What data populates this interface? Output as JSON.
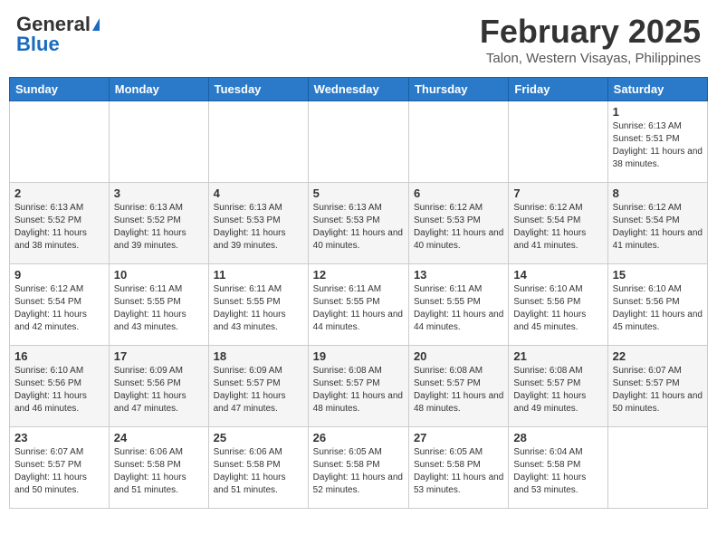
{
  "header": {
    "logo_line1": "General",
    "logo_line2": "Blue",
    "month_year": "February 2025",
    "location": "Talon, Western Visayas, Philippines"
  },
  "days_of_week": [
    "Sunday",
    "Monday",
    "Tuesday",
    "Wednesday",
    "Thursday",
    "Friday",
    "Saturday"
  ],
  "weeks": [
    [
      {
        "day": "",
        "info": ""
      },
      {
        "day": "",
        "info": ""
      },
      {
        "day": "",
        "info": ""
      },
      {
        "day": "",
        "info": ""
      },
      {
        "day": "",
        "info": ""
      },
      {
        "day": "",
        "info": ""
      },
      {
        "day": "1",
        "info": "Sunrise: 6:13 AM\nSunset: 5:51 PM\nDaylight: 11 hours and 38 minutes."
      }
    ],
    [
      {
        "day": "2",
        "info": "Sunrise: 6:13 AM\nSunset: 5:52 PM\nDaylight: 11 hours and 38 minutes."
      },
      {
        "day": "3",
        "info": "Sunrise: 6:13 AM\nSunset: 5:52 PM\nDaylight: 11 hours and 39 minutes."
      },
      {
        "day": "4",
        "info": "Sunrise: 6:13 AM\nSunset: 5:53 PM\nDaylight: 11 hours and 39 minutes."
      },
      {
        "day": "5",
        "info": "Sunrise: 6:13 AM\nSunset: 5:53 PM\nDaylight: 11 hours and 40 minutes."
      },
      {
        "day": "6",
        "info": "Sunrise: 6:12 AM\nSunset: 5:53 PM\nDaylight: 11 hours and 40 minutes."
      },
      {
        "day": "7",
        "info": "Sunrise: 6:12 AM\nSunset: 5:54 PM\nDaylight: 11 hours and 41 minutes."
      },
      {
        "day": "8",
        "info": "Sunrise: 6:12 AM\nSunset: 5:54 PM\nDaylight: 11 hours and 41 minutes."
      }
    ],
    [
      {
        "day": "9",
        "info": "Sunrise: 6:12 AM\nSunset: 5:54 PM\nDaylight: 11 hours and 42 minutes."
      },
      {
        "day": "10",
        "info": "Sunrise: 6:11 AM\nSunset: 5:55 PM\nDaylight: 11 hours and 43 minutes."
      },
      {
        "day": "11",
        "info": "Sunrise: 6:11 AM\nSunset: 5:55 PM\nDaylight: 11 hours and 43 minutes."
      },
      {
        "day": "12",
        "info": "Sunrise: 6:11 AM\nSunset: 5:55 PM\nDaylight: 11 hours and 44 minutes."
      },
      {
        "day": "13",
        "info": "Sunrise: 6:11 AM\nSunset: 5:55 PM\nDaylight: 11 hours and 44 minutes."
      },
      {
        "day": "14",
        "info": "Sunrise: 6:10 AM\nSunset: 5:56 PM\nDaylight: 11 hours and 45 minutes."
      },
      {
        "day": "15",
        "info": "Sunrise: 6:10 AM\nSunset: 5:56 PM\nDaylight: 11 hours and 45 minutes."
      }
    ],
    [
      {
        "day": "16",
        "info": "Sunrise: 6:10 AM\nSunset: 5:56 PM\nDaylight: 11 hours and 46 minutes."
      },
      {
        "day": "17",
        "info": "Sunrise: 6:09 AM\nSunset: 5:56 PM\nDaylight: 11 hours and 47 minutes."
      },
      {
        "day": "18",
        "info": "Sunrise: 6:09 AM\nSunset: 5:57 PM\nDaylight: 11 hours and 47 minutes."
      },
      {
        "day": "19",
        "info": "Sunrise: 6:08 AM\nSunset: 5:57 PM\nDaylight: 11 hours and 48 minutes."
      },
      {
        "day": "20",
        "info": "Sunrise: 6:08 AM\nSunset: 5:57 PM\nDaylight: 11 hours and 48 minutes."
      },
      {
        "day": "21",
        "info": "Sunrise: 6:08 AM\nSunset: 5:57 PM\nDaylight: 11 hours and 49 minutes."
      },
      {
        "day": "22",
        "info": "Sunrise: 6:07 AM\nSunset: 5:57 PM\nDaylight: 11 hours and 50 minutes."
      }
    ],
    [
      {
        "day": "23",
        "info": "Sunrise: 6:07 AM\nSunset: 5:57 PM\nDaylight: 11 hours and 50 minutes."
      },
      {
        "day": "24",
        "info": "Sunrise: 6:06 AM\nSunset: 5:58 PM\nDaylight: 11 hours and 51 minutes."
      },
      {
        "day": "25",
        "info": "Sunrise: 6:06 AM\nSunset: 5:58 PM\nDaylight: 11 hours and 51 minutes."
      },
      {
        "day": "26",
        "info": "Sunrise: 6:05 AM\nSunset: 5:58 PM\nDaylight: 11 hours and 52 minutes."
      },
      {
        "day": "27",
        "info": "Sunrise: 6:05 AM\nSunset: 5:58 PM\nDaylight: 11 hours and 53 minutes."
      },
      {
        "day": "28",
        "info": "Sunrise: 6:04 AM\nSunset: 5:58 PM\nDaylight: 11 hours and 53 minutes."
      },
      {
        "day": "",
        "info": ""
      }
    ]
  ]
}
